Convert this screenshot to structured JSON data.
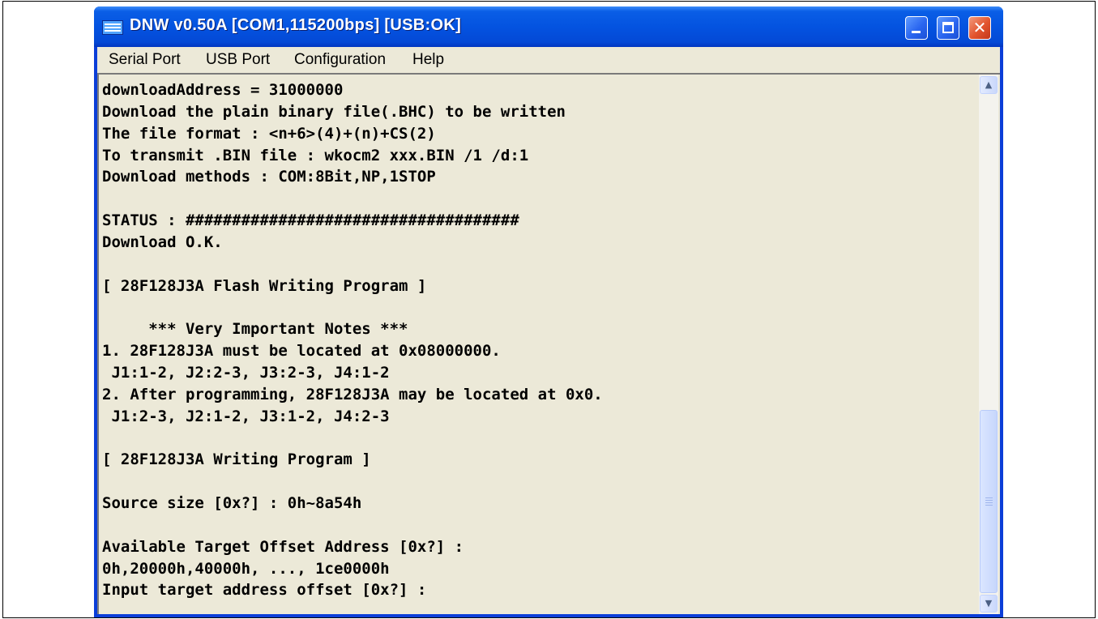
{
  "window": {
    "title": "DNW v0.50A   [COM1,115200bps] [USB:OK]",
    "icon": "app-window-icon",
    "controls": {
      "minimize": "minimize-icon",
      "maximize": "maximize-icon",
      "close": "close-icon",
      "close_glyph": "✕"
    }
  },
  "menu": {
    "items": [
      {
        "label": "Serial Port"
      },
      {
        "label": "USB Port"
      },
      {
        "label": "Configuration"
      },
      {
        "label": "Help"
      }
    ]
  },
  "terminal": {
    "lines": [
      "downloadAddress = 31000000",
      "Download the plain binary file(.BHC) to be written",
      "The file format : <n+6>(4)+(n)+CS(2)",
      "To transmit .BIN file : wkocm2 xxx.BIN /1 /d:1",
      "Download methods : COM:8Bit,NP,1STOP",
      "",
      "STATUS : ####################################",
      "Download O.K.",
      "",
      "[ 28F128J3A Flash Writing Program ]",
      "",
      "     *** Very Important Notes ***",
      "1. 28F128J3A must be located at 0x08000000.",
      " J1:1-2, J2:2-3, J3:2-3, J4:1-2",
      "2. After programming, 28F128J3A may be located at 0x0.",
      " J1:2-3, J2:1-2, J3:1-2, J4:2-3",
      "",
      "[ 28F128J3A Writing Program ]",
      "",
      "Source size [0x?] : 0h~8a54h",
      "",
      "Available Target Offset Address [0x?] :",
      "0h,20000h,40000h, ..., 1ce0000h",
      "Input target address offset [0x?] :"
    ]
  },
  "scrollbar": {
    "up_glyph": "▲",
    "down_glyph": "▼",
    "position": "bottom"
  },
  "colors": {
    "titlebar": "#0453e0",
    "client_bg": "#ece9d8",
    "close_button": "#e2542e"
  }
}
